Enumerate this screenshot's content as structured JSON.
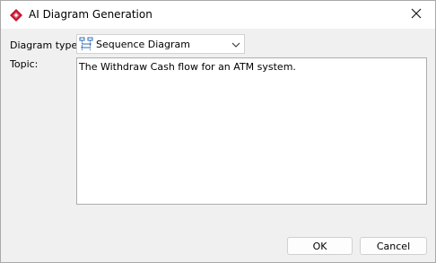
{
  "window": {
    "title": "AI Diagram Generation",
    "app_icon": "visual-paradigm-diamond-icon",
    "close_icon": "close-icon"
  },
  "form": {
    "diagram_type_label": "Diagram type:",
    "diagram_type_value": "Sequence Diagram",
    "diagram_type_icon": "sequence-diagram-icon",
    "topic_label": "Topic:",
    "topic_value": "The Withdraw Cash flow for an ATM system."
  },
  "buttons": {
    "ok_label": "OK",
    "cancel_label": "Cancel"
  },
  "colors": {
    "accent_red": "#c8102e",
    "diagram_icon_blue": "#2f6db5",
    "title_bg": "#ffffff",
    "dialog_bg": "#f0f0f0"
  }
}
